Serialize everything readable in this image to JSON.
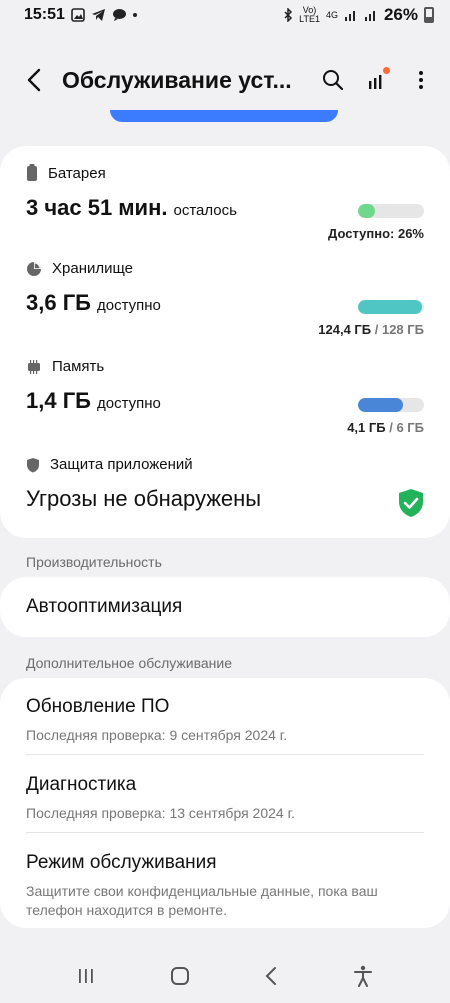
{
  "status_bar": {
    "time": "15:51",
    "network_top": "Vo)",
    "network_bottom": "LTE1",
    "network_type": "4G",
    "battery": "26%"
  },
  "header": {
    "title": "Обслуживание уст..."
  },
  "battery": {
    "label": "Батарея",
    "value": "3 час 51 мин.",
    "suffix": "осталось",
    "right_text": "Доступно: 26%",
    "level": 0.26,
    "color": "#6fd88c"
  },
  "storage": {
    "label": "Хранилище",
    "value": "3,6 ГБ",
    "suffix": "доступно",
    "used": "124,4 ГБ",
    "total": "/ 128 ГБ",
    "level": 0.97,
    "color": "#4fc6c3"
  },
  "memory": {
    "label": "Память",
    "value": "1,4 ГБ",
    "suffix": "доступно",
    "used": "4,1 ГБ",
    "total": "/ 6 ГБ",
    "level": 0.68,
    "color": "#4a86d8"
  },
  "protection": {
    "label": "Защита приложений",
    "value": "Угрозы не обнаружены",
    "color": "#22b35a"
  },
  "performance": {
    "section_title": "Производительность",
    "item": "Автооптимизация"
  },
  "additional": {
    "section_title": "Дополнительное обслуживание",
    "items": [
      {
        "title": "Обновление ПО",
        "subtitle": "Последняя проверка: 9 сентября 2024 г."
      },
      {
        "title": "Диагностика",
        "subtitle": "Последняя проверка: 13 сентября 2024 г."
      },
      {
        "title": "Режим обслуживания",
        "subtitle": "Защитите свои конфиденциальные данные, пока ваш телефон находится в ремонте."
      }
    ]
  },
  "colors": {
    "accent": "#3b7cff",
    "background": "#f1f1f3"
  }
}
